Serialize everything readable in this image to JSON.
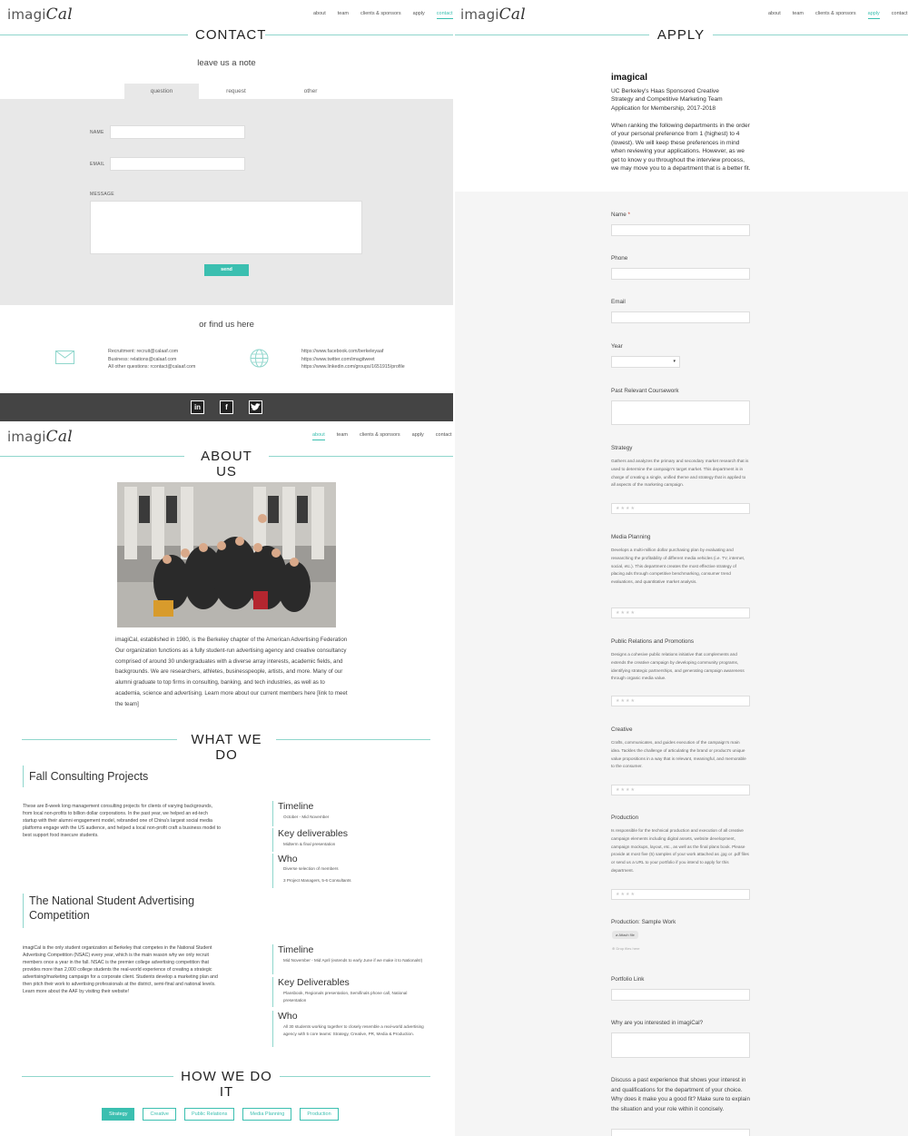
{
  "contact_page": {
    "logo": {
      "main": "imagi",
      "accent": "Cal"
    },
    "nav": [
      "about",
      "team",
      "clients & sponsors",
      "apply",
      "contact"
    ],
    "active_nav": "contact",
    "title": "CONTACT",
    "subtitle": "leave us a note",
    "tabs": [
      "question",
      "request",
      "other"
    ],
    "form": {
      "name_label": "NAME",
      "email_label": "EMAIL",
      "message_label": "MESSAGE",
      "send_label": "send"
    },
    "find_title": "or find us here",
    "emails": [
      "Recruitment: recruit@calaaf.com",
      "Business: relations@calaaf.com",
      "All other questions: rcontact@calaaf.com"
    ],
    "links": [
      "https://www.facebook.com/berkeleyaaf",
      "https://www.twitter.com/imagitweet",
      "https://www.linkedin.com/groups/1651915/profile"
    ],
    "social": [
      "in",
      "f",
      "t"
    ]
  },
  "about_page": {
    "logo": {
      "main": "imagi",
      "accent": "Cal"
    },
    "nav": [
      "about",
      "team",
      "clients & sponsors",
      "apply",
      "contact"
    ],
    "active_nav": "about",
    "title": "ABOUT US",
    "intro": "imagiCal, established in 1980, is the Berkeley chapter of the American Advertising Federation Our organization functions as a fully student-run advertising agency and creative consultancy comprised of around 30 undergraduates with a diverse array interests, academic fields, and backgrounds. We are researchers, athletes, businesspeople, artists, and more. Many of our alumni graduate to top firms in consulting, banking, and tech industries, as well as to academia, science and advertising. Learn more about our current members here [link to meet the team]",
    "what_title": "WHAT WE DO",
    "projects": [
      {
        "title": "Fall Consulting Projects",
        "text": "These are 8-week long management consulting projects for clients of varying backgrounds, from local non-profits to billion dollar corporations. In the past year, we helped an ed-tech startup with their alumni engagement model, rebranded one of China's largest social media platforms engage with the US audience, and helped a local non-profit craft a business model to best support food insecure students.",
        "side": [
          {
            "h": "Timeline",
            "d": "October - Mid November"
          },
          {
            "h": "Key deliverables",
            "d": "Midterm & final presentation"
          },
          {
            "h": "Who",
            "d": "Diverse selection of members\n\n3 Project Managers, 5-6 Consultants"
          }
        ]
      },
      {
        "title": "The National Student Advertising Competition",
        "text": "imagiCal is the only student organization at Berkeley that competes in the National Student Advertising Competition (NSAC) every year, which is the main reason why we only recruit members once a year in the fall. NSAC is the premier college advertising competition that provides more than 2,000 college students the real-world experience of creating a strategic advertising/marketing campaign for a corporate client. Students develop a marketing plan and then pitch their work to advertising professionals at the district, semi-final and national levels. Learn more about the AAF by visiting their website!",
        "side": [
          {
            "h": "Timeline",
            "d": "Mid November - Mid April (extends to early June if we make it to Nationals!)"
          },
          {
            "h": "Key Deliverables",
            "d": "Plansbook, Regionals presentation, Semifinals phone call, National presentation"
          },
          {
            "h": "Who",
            "d": "All 30 students working together to closely resemble a real-world advertising agency with 5 core teams: Strategy, Creative, PR, Media & Production."
          }
        ]
      }
    ],
    "how_title": "HOW WE DO IT",
    "how_tabs": [
      "Strategy",
      "Creative",
      "Public Relations",
      "Media Planning",
      "Production"
    ],
    "active_how": "Strategy"
  },
  "apply_page": {
    "logo": {
      "main": "imagi",
      "accent": "Cal"
    },
    "nav": [
      "about",
      "team",
      "clients & sponsors",
      "apply",
      "contact"
    ],
    "active_nav": "apply",
    "title": "APPLY",
    "org": "imagical",
    "subtitle": "UC Berkeley's Haas Sponsored Creative Strategy and Competitive Marketing Team Application for Membership, 2017-2018",
    "instructions": "When ranking the following departments in the order of your personal preference from 1 (highest) to 4 (lowest). We will keep these preferences in mind when reviewing your applications. However, as we get to know y ou throughout the interview process, we may move you to a department that is a better fit.",
    "fields": {
      "name": "Name",
      "required_mark": "*",
      "phone": "Phone",
      "email": "Email",
      "year": "Year",
      "coursework": "Past Relevant Coursework"
    },
    "departments": [
      {
        "name": "Strategy",
        "desc": "Gathers and analyzes the primary and secondary market research that is used to determine the campaign's target market. This department is in charge of creating a single, unified theme and strategy that is applied to all aspects of the marketing campaign."
      },
      {
        "name": "Media Planning",
        "desc": "Develops a multi-million dollar purchasing plan by evaluating and researching the profitability of different media vehicles (i.e. TV, internet, social, etc.). This department creates the most effective strategy of placing ads through competitive benchmarking, consumer trend evaluations, and quantitative market analysis."
      },
      {
        "name": "Public Relations and Promotions",
        "desc": "Designs a cohesive public relations initiative that complements and extends the creative campaign by developing community programs, identifying strategic partnerships, and generating campaign awareness through organic media value."
      },
      {
        "name": "Creative",
        "desc": "Crafts, communicates, and guides execution of the campaign's main idea. Tackles the challenge of articulating the brand or product's unique value propositions in a way that is relevant, meaningful, and memorable to the consumer."
      },
      {
        "name": "Production",
        "desc": "Is responsible for the technical production and execution of all creative campaign elements including digital assets, website development, campaign mockups, layout, etc., as well as the final plans book. Please provide at most five (5) samples of your work attached as .jpg or .pdf files or send us a URL to your portfolio if you intend to apply for this department."
      }
    ],
    "stars": "★★★★",
    "sample_work": "Production: Sample Work",
    "attach_label": "Attach file",
    "drop_label": "Drop files here",
    "portfolio": "Portfolio Link",
    "why": "Why are you interested in imagiCal?",
    "experience": "Discuss a past experience that shows your interest in and qualifications for the department of your choice. Why does it make you a good fit? Make sure to explain the situation and your role within it concisely."
  }
}
